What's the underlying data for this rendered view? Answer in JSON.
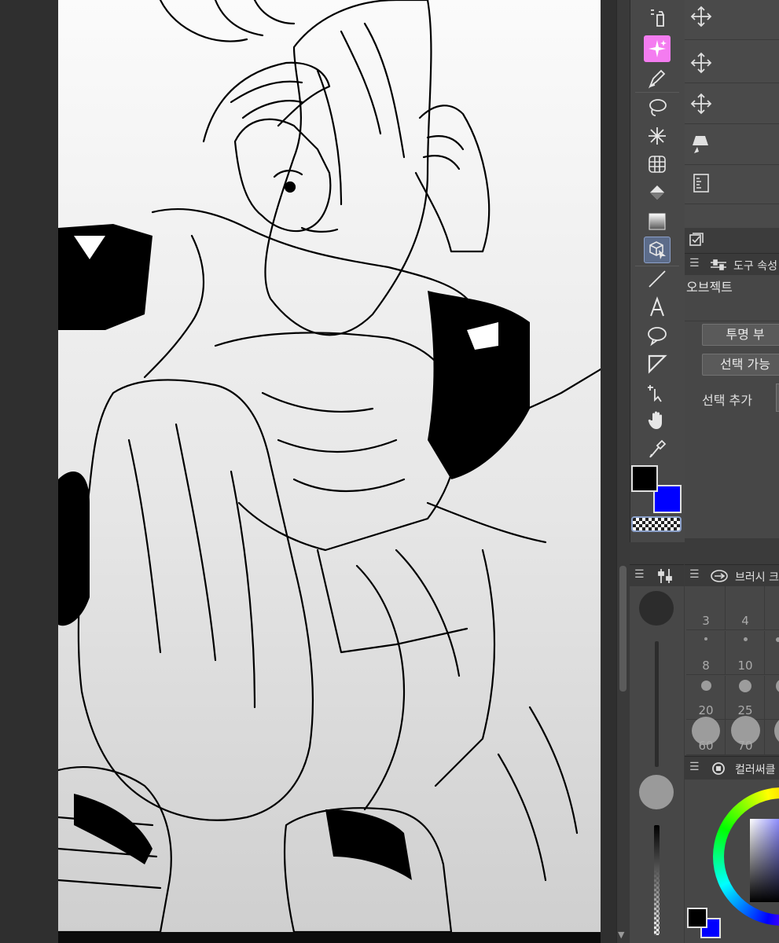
{
  "tool_property": {
    "header_title": "도구 속성",
    "tool_name": "오브젝트",
    "transparent_button": "투명 부",
    "selectable_button": "선택 가능",
    "add_selection_label": "선택 추가"
  },
  "brush_size": {
    "header_title": "브러시 크",
    "sizes": [
      "3",
      "4",
      "8",
      "10",
      "20",
      "25",
      "60",
      "70"
    ]
  },
  "color_circle": {
    "header_title": "컬러써클"
  },
  "colors": {
    "main": "#000000",
    "sub": "#0000ff",
    "active_highlight": "#f47cf0"
  },
  "tools": [
    "pen-tool-icon",
    "magic-select-icon",
    "pen-nib-icon",
    "lasso-icon",
    "sparkle-icon",
    "mesh-icon",
    "fill-bucket-icon",
    "gradient-icon",
    "operation-icon",
    "line-icon",
    "text-icon",
    "balloon-icon",
    "frame-icon",
    "correct-line-icon",
    "hand-icon",
    "eyedropper-icon"
  ]
}
